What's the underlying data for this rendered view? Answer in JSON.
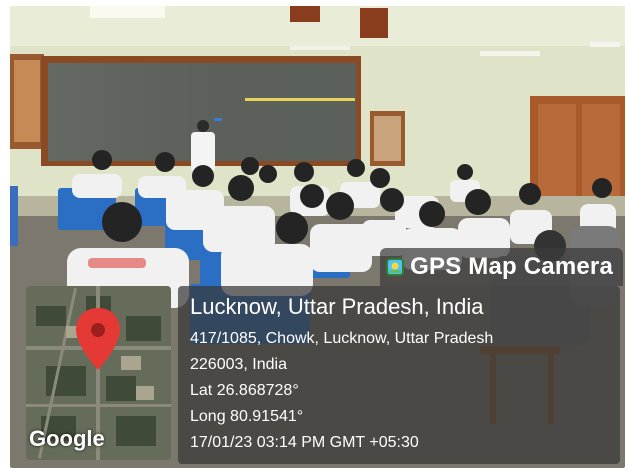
{
  "badge": {
    "title": "GPS Map Camera",
    "icon": "map-camera-app-icon"
  },
  "location": {
    "city": "Lucknow, Uttar Pradesh, India",
    "address_line1": "417/1085, Chowk, Lucknow, Uttar Pradesh",
    "address_line2": "226003, India",
    "lat": "Lat 26.868728°",
    "long": "Long 80.91541°",
    "timestamp": "17/01/23 03:14 PM GMT +05:30"
  },
  "map": {
    "provider": "Google",
    "marker_icon": "map-pin-icon",
    "marker_color": "#e53935"
  },
  "colors": {
    "wall": "#dde3c8",
    "blackboard": "#5a5f58",
    "board_frame": "#8a4a24",
    "chairs": "#2a6fc4",
    "uniform": "#f2f2f2",
    "floor": "#7d7a70"
  }
}
